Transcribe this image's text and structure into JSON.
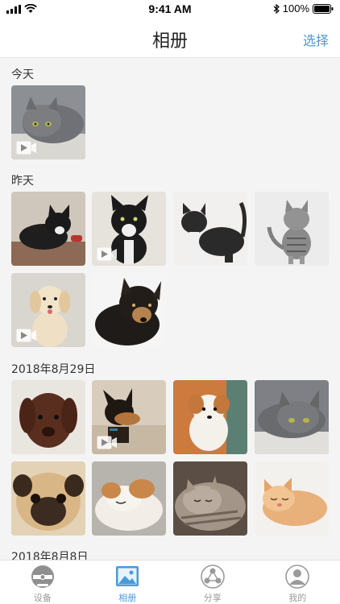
{
  "status": {
    "time": "9:41 AM",
    "battery": "100%"
  },
  "nav": {
    "title": "相册",
    "select_label": "选择"
  },
  "sections": [
    {
      "label": "今天"
    },
    {
      "label": "昨天"
    },
    {
      "label": "2018年8月29日"
    },
    {
      "label": "2018年8月8日"
    }
  ],
  "tabs": [
    {
      "label": "设备",
      "icon": "device-icon"
    },
    {
      "label": "相册",
      "icon": "album-icon",
      "active": true
    },
    {
      "label": "分享",
      "icon": "share-icon"
    },
    {
      "label": "我的",
      "icon": "profile-icon"
    }
  ],
  "colors": {
    "accent": "#4a9ad9",
    "tab_inactive": "#9a9a9a"
  }
}
